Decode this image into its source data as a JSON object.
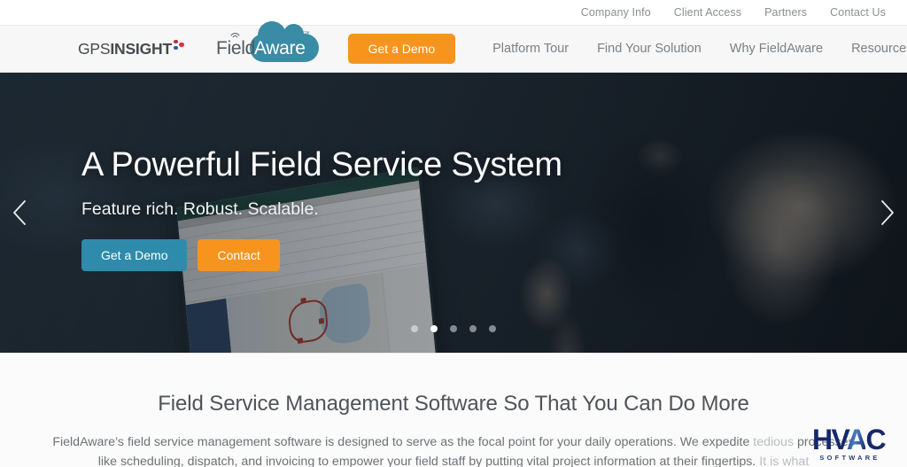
{
  "topbar": {
    "links": [
      {
        "label": "Company Info"
      },
      {
        "label": "Client Access"
      },
      {
        "label": "Partners"
      },
      {
        "label": "Contact Us"
      }
    ]
  },
  "header": {
    "logo_gps": {
      "text_light": "GPS",
      "text_bold": "INSIGHT",
      "dot_colors": [
        "#b4323c",
        "#2b5fa8",
        "#d9333f"
      ]
    },
    "logo_fieldaware": {
      "part_one": "Field",
      "part_two": "Aware",
      "trademark": "™",
      "cloud_color": "#3a8ba5"
    },
    "demo_button": "Get a Demo",
    "nav_links": [
      {
        "label": "Platform Tour"
      },
      {
        "label": "Find Your Solution"
      },
      {
        "label": "Why FieldAware"
      },
      {
        "label": "Resources"
      }
    ],
    "search_icon": "search-icon",
    "accent_orange": "#f7941e"
  },
  "hero": {
    "title": "A Powerful Field Service System",
    "subtitle": "Feature rich. Robust. Scalable.",
    "buttons": {
      "primary": "Get a Demo",
      "secondary": "Contact"
    },
    "prev_arrow": "chevron-left-icon",
    "next_arrow": "chevron-right-icon",
    "slides": 5,
    "active_slide": 2,
    "primary_color": "#2e8bab",
    "secondary_color": "#f7941e"
  },
  "intro": {
    "heading": "Field Service Management Software So That You Can Do More",
    "body_line1": "FieldAware’s field service management software is designed to serve as the focal point for your daily operations. We expedite ",
    "body_line1_faded": "tedious",
    "body_line2": "processes like scheduling, dispatch, and invoicing to empower your field staff by putting vital project information at their fingertips. ",
    "body_line2_faded": "It is what"
  },
  "watermark": {
    "brand_h": "H",
    "brand_v": "V",
    "brand_a": "A",
    "brand_c": "C",
    "subtitle": "SOFTWARE",
    "color": "#16286b"
  }
}
